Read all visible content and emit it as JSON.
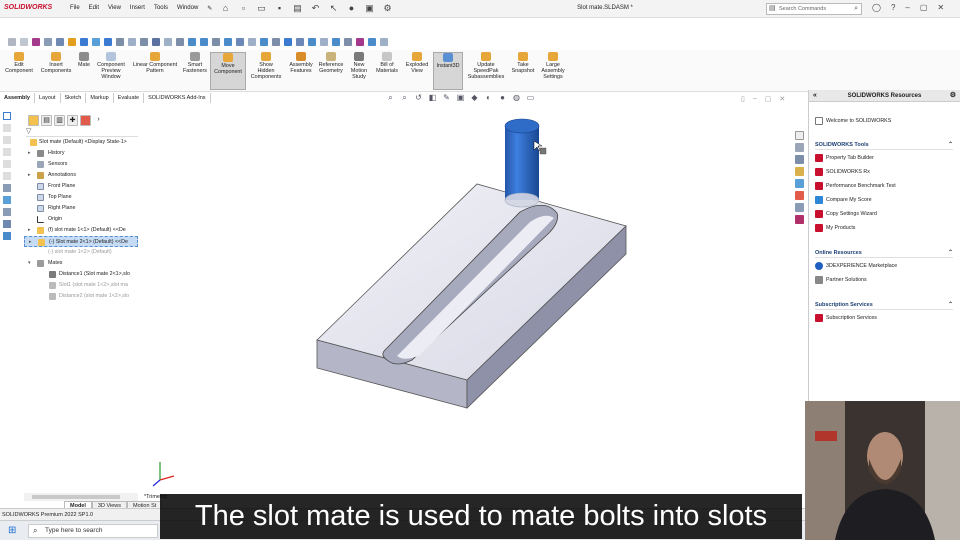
{
  "app": {
    "logo": "SOLIDWORKS",
    "document_title": "Slot mate.SLDASM *",
    "menu": [
      "File",
      "Edit",
      "View",
      "Insert",
      "Tools",
      "Window"
    ],
    "search_placeholder": "Search Commands"
  },
  "command_manager": {
    "commands": [
      {
        "label": "Edit\nComponent",
        "icon": "edit-component-icon"
      },
      {
        "label": "Insert\nComponents",
        "icon": "insert-components-icon"
      },
      {
        "label": "Mate",
        "icon": "mate-icon"
      },
      {
        "label": "Component\nPreview\nWindow",
        "icon": "preview-window-icon"
      },
      {
        "label": "Linear Component\nPattern",
        "icon": "linear-pattern-icon"
      },
      {
        "label": "Smart\nFasteners",
        "icon": "smart-fasteners-icon"
      },
      {
        "label": "Move\nComponent",
        "icon": "move-component-icon"
      },
      {
        "label": "Show\nHidden\nComponents",
        "icon": "show-hidden-icon"
      },
      {
        "label": "Assembly\nFeatures",
        "icon": "assembly-features-icon"
      },
      {
        "label": "Reference\nGeometry",
        "icon": "reference-geometry-icon"
      },
      {
        "label": "New\nMotion\nStudy",
        "icon": "motion-study-icon"
      },
      {
        "label": "Bill of\nMaterials",
        "icon": "bom-icon"
      },
      {
        "label": "Exploded\nView",
        "icon": "exploded-view-icon"
      },
      {
        "label": "Instant3D",
        "icon": "instant3d-icon"
      },
      {
        "label": "Update\nSpeedPak\nSubassemblies",
        "icon": "speedpak-icon"
      },
      {
        "label": "Take\nSnapshot",
        "icon": "snapshot-icon"
      },
      {
        "label": "Large\nAssembly\nSettings",
        "icon": "large-assembly-icon"
      }
    ]
  },
  "tabs": [
    "Assembly",
    "Layout",
    "Sketch",
    "Markup",
    "Evaluate",
    "SOLIDWORKS Add-Ins"
  ],
  "feature_tree": {
    "nodes": [
      {
        "text": "Slot mate  (Default) <Display State-1>",
        "level": 0,
        "arrow": ""
      },
      {
        "text": "History",
        "level": 1,
        "arrow": "▸"
      },
      {
        "text": "Sensors",
        "level": 1,
        "arrow": ""
      },
      {
        "text": "Annotations",
        "level": 1,
        "arrow": "▸"
      },
      {
        "text": "Front Plane",
        "level": 1,
        "arrow": ""
      },
      {
        "text": "Top Plane",
        "level": 1,
        "arrow": ""
      },
      {
        "text": "Right Plane",
        "level": 1,
        "arrow": ""
      },
      {
        "text": "Origin",
        "level": 1,
        "arrow": ""
      },
      {
        "text": "(f) slot mate 1<1> (Default) <<De",
        "level": 1,
        "arrow": "▸"
      },
      {
        "text": "(-) Slot mate 2<1> (Default) <<De",
        "level": 1,
        "arrow": "▸"
      },
      {
        "text": "(-) slot mate 1<2> (Default)",
        "level": 1,
        "arrow": ""
      },
      {
        "text": "Mates",
        "level": 1,
        "arrow": "▾"
      },
      {
        "text": "Distance1 (Slot mate 2<1>,slo",
        "level": 2,
        "arrow": ""
      },
      {
        "text": "Slot1 (slot mate 1<2>,slot ma",
        "level": 2,
        "arrow": ""
      },
      {
        "text": "Distance2 (slot mate 1<2>,slo",
        "level": 2,
        "arrow": ""
      }
    ]
  },
  "view_label": "*Trimetric",
  "bottom_tabs": [
    "Model",
    "3D Views",
    "Motion St"
  ],
  "status_text": "SOLIDWORKS Premium 2022 SP1.0",
  "resources": {
    "title": "SOLIDWORKS Resources",
    "welcome": "Welcome to SOLIDWORKS",
    "sections": [
      {
        "title": "SOLIDWORKS Tools",
        "items": [
          "Property Tab Builder",
          "SOLIDWORKS Rx",
          "Performance Benchmark Test",
          "Compare My Score",
          "Copy Settings Wizard",
          "My Products"
        ]
      },
      {
        "title": "Online Resources",
        "items": [
          "3DEXPERIENCE Marketplace",
          "Partner Solutions"
        ]
      },
      {
        "title": "Subscription Services",
        "items": [
          "Subscription Services"
        ]
      }
    ]
  },
  "taskbar": {
    "search_placeholder": "Type here to search"
  },
  "caption": "The slot mate is used to mate bolts into slots",
  "colors": {
    "accent_red": "#c8102e",
    "part_blue": "#1f5fbf",
    "selection": "#c6dcf5"
  }
}
